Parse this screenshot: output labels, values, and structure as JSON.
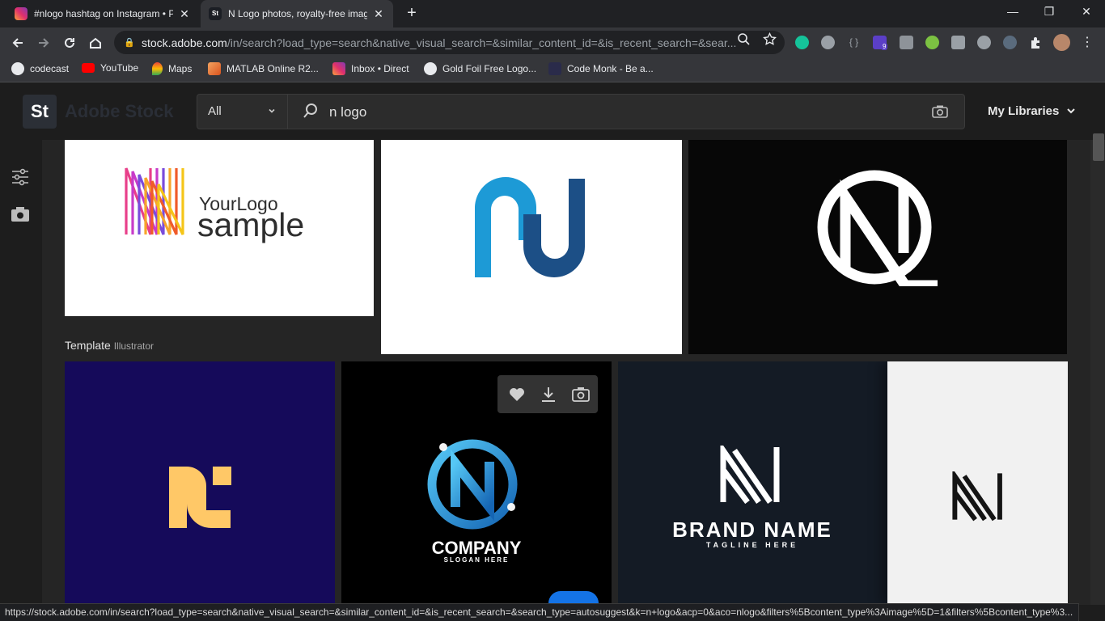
{
  "browser": {
    "tabs": [
      {
        "title": "#nlogo hashtag on Instagram • P",
        "active": false,
        "icon": "instagram-icon"
      },
      {
        "title": "N Logo photos, royalty-free imag",
        "active": true,
        "icon": "adobe-stock-icon"
      }
    ],
    "new_tab": "+",
    "window": {
      "minimize": "—",
      "restore": "❐",
      "close": "✕"
    },
    "address": {
      "host": "stock.adobe.com",
      "path": "/in/search?load_type=search&native_visual_search=&similar_content_id=&is_recent_search=&sear..."
    },
    "bookmarks": [
      {
        "label": "codecast",
        "icon": "globe-icon"
      },
      {
        "label": "YouTube",
        "icon": "youtube-icon"
      },
      {
        "label": "Maps",
        "icon": "maps-pin-icon"
      },
      {
        "label": "MATLAB Online R2...",
        "icon": "matlab-icon"
      },
      {
        "label": "Inbox • Direct",
        "icon": "instagram-icon"
      },
      {
        "label": "Gold Foil Free Logo...",
        "icon": "globe-icon"
      },
      {
        "label": "Code Monk - Be a...",
        "icon": "code-monk-icon"
      }
    ],
    "extension_badge": "9",
    "status_url": "https://stock.adobe.com/in/search?load_type=search&native_visual_search=&similar_content_id=&is_recent_search=&search_type=autosuggest&k=n+logo&acp=0&aco=nlogo&filters%5Bcontent_type%3Aimage%5D=1&filters%5Bcontent_type%3..."
  },
  "stock": {
    "logo_text": "St",
    "wordmark": "Adobe Stock",
    "search": {
      "scope": "All",
      "query": "n logo"
    },
    "libraries_label": "My Libraries",
    "section": {
      "title": "Template",
      "subtitle": "Illustrator"
    },
    "tiles": {
      "yourlogo": {
        "line1": "YourLogo",
        "line2": "sample"
      },
      "company": {
        "name": "COMPANY",
        "slogan": "SLOGAN HERE"
      },
      "brand": {
        "name": "BRAND NAME",
        "tagline": "TAGLINE HERE"
      }
    }
  },
  "colors": {
    "accent_blue": "#1473e6",
    "deep_indigo": "#150a5a",
    "mustard": "#ffc867"
  }
}
